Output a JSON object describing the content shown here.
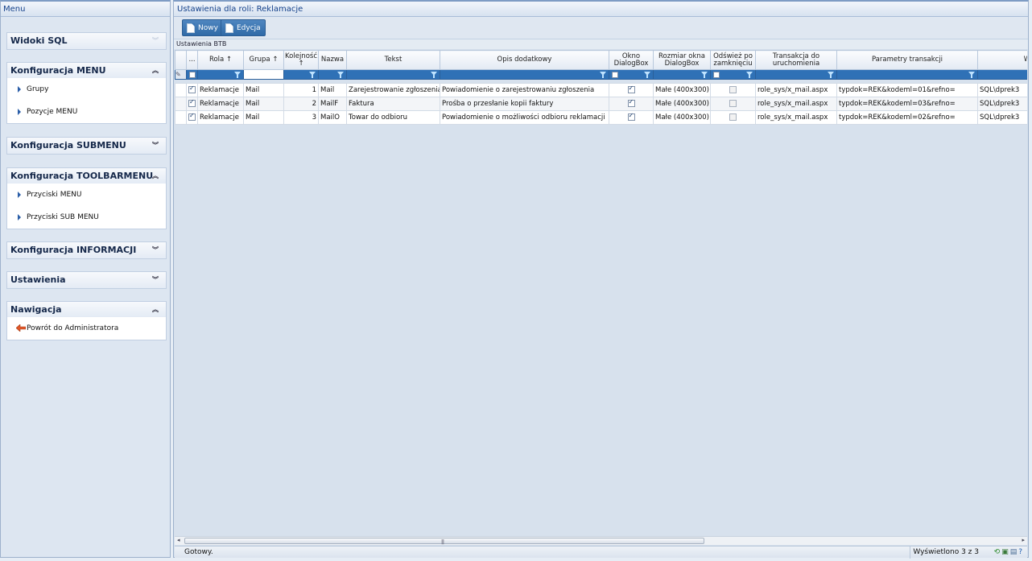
{
  "left_panel": {
    "title": "Menu",
    "sections": [
      {
        "title": "Widoki SQL",
        "expanded": false,
        "items": []
      },
      {
        "title": "Konfiguracja MENU",
        "expanded": true,
        "items": [
          "Grupy",
          "Pozycje MENU"
        ]
      },
      {
        "title": "Konfiguracja SUBMENU",
        "expanded": false,
        "items": []
      },
      {
        "title": "Konfiguracja TOOLBARMENU",
        "expanded": true,
        "items": [
          "Przyciski MENU",
          "Przyciski SUB MENU"
        ]
      },
      {
        "title": "Konfiguracja INFORMACJI",
        "expanded": false,
        "items": []
      },
      {
        "title": "Ustawienia",
        "expanded": false,
        "items": []
      },
      {
        "title": "Nawigacja",
        "expanded": true,
        "items": [
          "Powrót do Administratora"
        ]
      }
    ]
  },
  "right_panel": {
    "title": "Ustawienia dla roli: Reklamacje",
    "toolbar": {
      "new_label": "Nowy",
      "edit_label": "Edycja"
    },
    "grid_title": "Ustawienia BTB",
    "columns": {
      "more": "...",
      "rola": "Rola ↑",
      "grupa": "Grupa ↑",
      "kolejnosc": "Kolejność ↑",
      "nazwa": "Nazwa",
      "tekst": "Tekst",
      "opis": "Opis dodatkowy",
      "okno": "Okno DialogBox",
      "rozmiar": "Rozmiar okna DialogBox",
      "odswiez": "Odśwież po zamknięciu",
      "transakcja": "Transakcja do uruchomienia",
      "parametry": "Parametry transakcji",
      "last": "W"
    },
    "rows": [
      {
        "checked": true,
        "rola": "Reklamacje",
        "grupa": "Mail",
        "kolejnosc": "1",
        "nazwa": "Mail",
        "tekst": "Zarejestrowanie zgłoszenia",
        "opis": "Powiadomienie o zarejestrowaniu zgłoszenia",
        "okno": true,
        "rozmiar": "Małe (400x300)",
        "odswiez": false,
        "transakcja": "role_sys/x_mail.aspx",
        "parametry": "typdok=REK&kodeml=01&refno=",
        "last": "SQL\\dprek3"
      },
      {
        "checked": true,
        "rola": "Reklamacje",
        "grupa": "Mail",
        "kolejnosc": "2",
        "nazwa": "MailF",
        "tekst": "Faktura",
        "opis": "Prośba o przesłanie kopii faktury",
        "okno": true,
        "rozmiar": "Małe (400x300)",
        "odswiez": false,
        "transakcja": "role_sys/x_mail.aspx",
        "parametry": "typdok=REK&kodeml=03&refno=",
        "last": "SQL\\dprek3"
      },
      {
        "checked": true,
        "rola": "Reklamacje",
        "grupa": "Mail",
        "kolejnosc": "3",
        "nazwa": "MailO",
        "tekst": "Towar do odbioru",
        "opis": "Powiadomienie o możliwości odbioru reklamacji",
        "okno": true,
        "rozmiar": "Małe (400x300)",
        "odswiez": false,
        "transakcja": "role_sys/x_mail.aspx",
        "parametry": "typdok=REK&kodeml=02&refno=",
        "last": "SQL\\dprek3"
      }
    ],
    "status": {
      "ready": "Gotowy.",
      "count": "Wyświetlono 3 z 3"
    }
  },
  "colors": {
    "accent": "#2f71b6",
    "title_text": "#15428b",
    "panel_bg": "#dde6f1"
  }
}
